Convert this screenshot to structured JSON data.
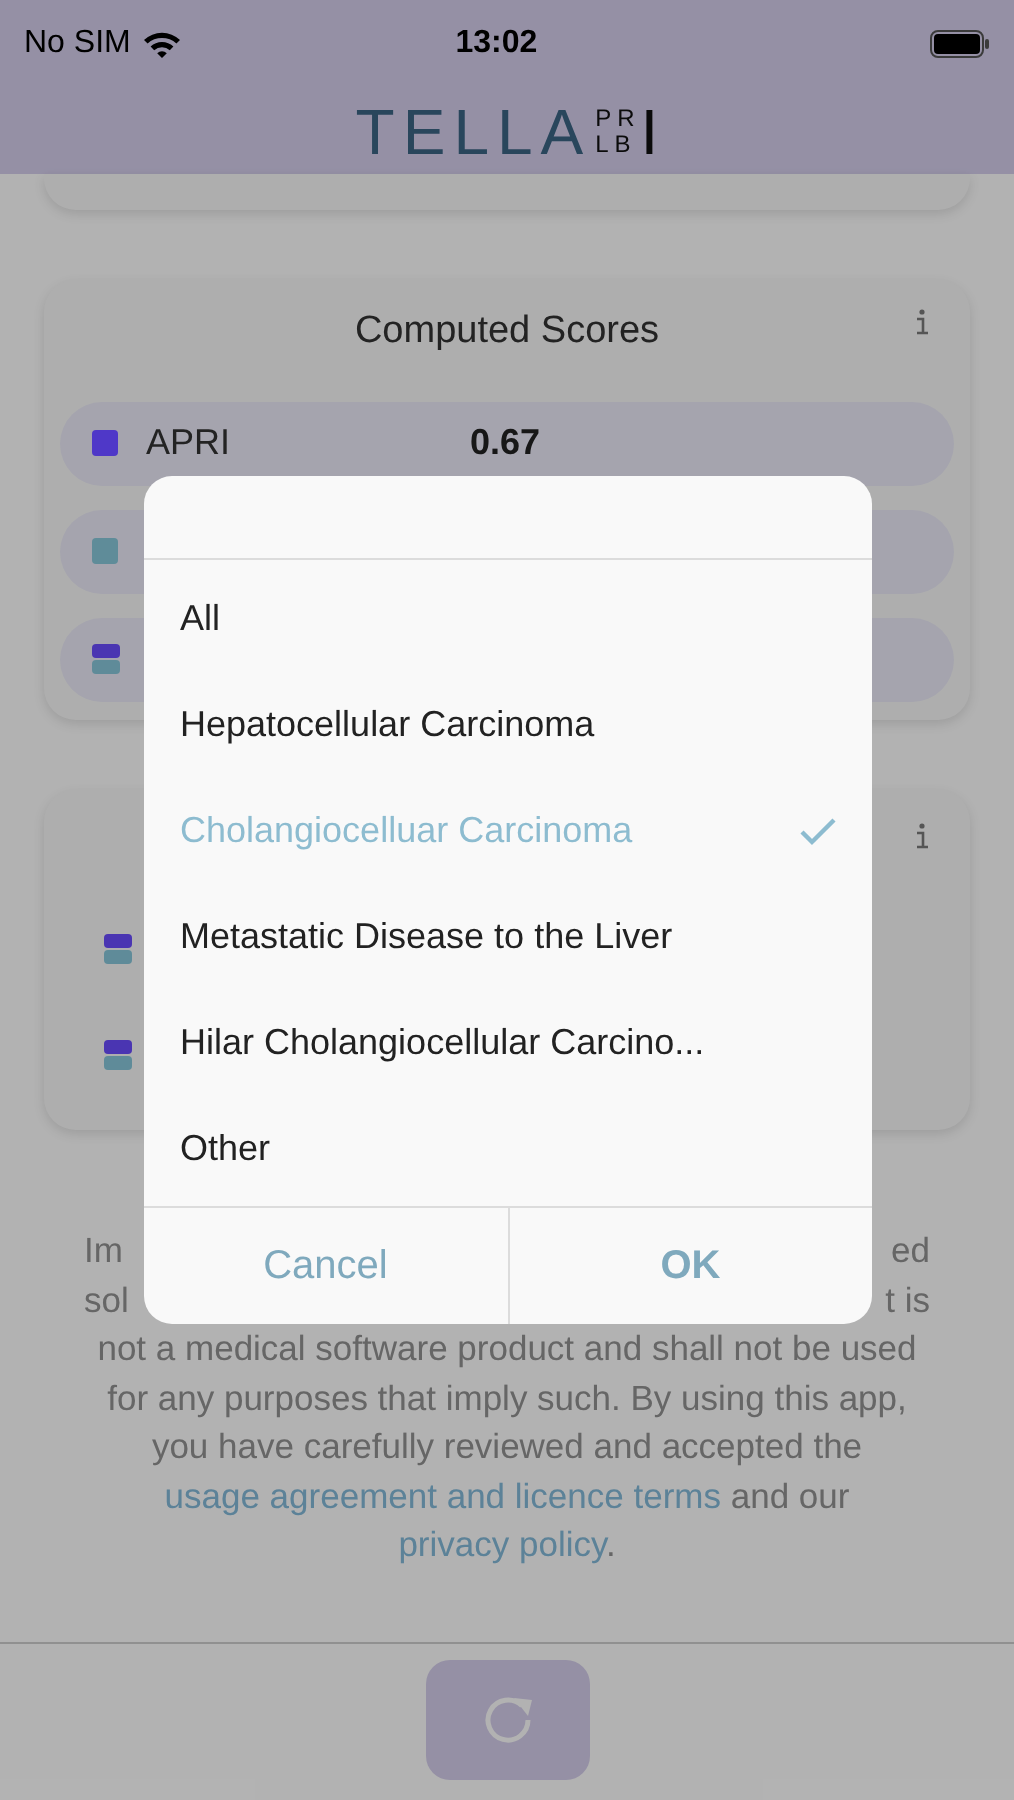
{
  "status_bar": {
    "carrier": "No SIM",
    "time": "13:02"
  },
  "header": {
    "logo": {
      "main": "TELLA",
      "stack_top": "PR",
      "stack_bottom": "LB",
      "tail": "I"
    }
  },
  "scores_card": {
    "title": "Computed Scores",
    "rows": [
      {
        "kind": "single",
        "color": "#4f38c8",
        "name": "APRI",
        "value": "0.67"
      },
      {
        "kind": "single",
        "color": "#5f8c99"
      },
      {
        "kind": "split"
      }
    ]
  },
  "second_card": {
    "rows": [
      {
        "kind": "split"
      },
      {
        "kind": "split"
      }
    ]
  },
  "disclaimer": {
    "covered_lines": [
      {
        "left": "Im",
        "right": "ed"
      },
      {
        "left": "sol",
        "right": "t is"
      }
    ],
    "text": "not a medical software product and shall not be used for any purposes that imply such. By using this app, you have carefully reviewed and accepted the",
    "link1": "usage agreement and licence terms",
    "middle": "and our",
    "link2": "privacy policy",
    "end": "."
  },
  "picker_dialog": {
    "items": [
      {
        "label": "All",
        "selected": false
      },
      {
        "label": "Hepatocellular Carcinoma",
        "selected": false
      },
      {
        "label": "Cholangiocelluar Carcinoma",
        "selected": true
      },
      {
        "label": "Metastatic Disease to the Liver",
        "selected": false
      },
      {
        "label": "Hilar Cholangiocellular Carcino...",
        "selected": false
      },
      {
        "label": "Other",
        "selected": false
      }
    ],
    "buttons": [
      {
        "label": "Cancel",
        "kind": "cancel"
      },
      {
        "label": "OK",
        "kind": "confirm"
      }
    ]
  }
}
